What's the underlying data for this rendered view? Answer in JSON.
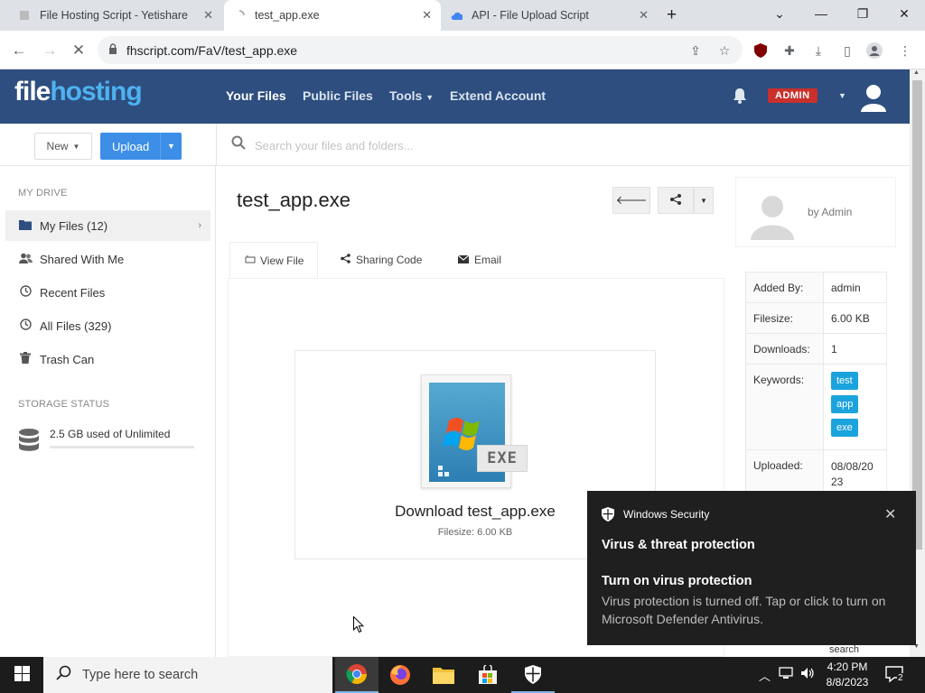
{
  "browser": {
    "tabs": [
      {
        "label": "File Hosting Script - Yetishare"
      },
      {
        "label": "test_app.exe"
      },
      {
        "label": "API - File Upload Script"
      }
    ],
    "url": "fhscript.com/FaV/test_app.exe"
  },
  "site": {
    "logo_a": "file",
    "logo_b": "hosting",
    "nav": [
      "Your Files",
      "Public Files",
      "Tools",
      "Extend Account"
    ],
    "admin_badge": "ADMIN"
  },
  "toolbar": {
    "new_label": "New",
    "upload_label": "Upload",
    "search_placeholder": "Search your files and folders..."
  },
  "sidebar": {
    "my_drive_heading": "MY DRIVE",
    "items": [
      {
        "label": "My Files (12)"
      },
      {
        "label": "Shared With Me"
      },
      {
        "label": "Recent Files"
      },
      {
        "label": "All Files (329)"
      },
      {
        "label": "Trash Can"
      }
    ],
    "storage_heading": "STORAGE STATUS",
    "storage_text": "2.5 GB used of Unlimited",
    "storage_fraction": 0
  },
  "file": {
    "title": "test_app.exe",
    "tabs": [
      "View File",
      "Sharing Code",
      "Email"
    ],
    "thumb_label": "EXE",
    "download_title": "Download test_app.exe",
    "download_size": "Filesize: 6.00 KB"
  },
  "owner": {
    "by": "by Admin"
  },
  "info": {
    "added_by_label": "Added By:",
    "added_by": "admin",
    "filesize_label": "Filesize:",
    "filesize": "6.00 KB",
    "downloads_label": "Downloads:",
    "downloads": "1",
    "keywords_label": "Keywords:",
    "keywords": [
      "test",
      "app",
      "exe"
    ],
    "uploaded_label": "Uploaded:",
    "uploaded": "08/08/2023",
    "search_tag": "search"
  },
  "toast": {
    "app": "Windows Security",
    "title": "Virus & threat protection",
    "subtitle": "Turn on virus protection",
    "body": "Virus protection is turned off. Tap or click to turn on Microsoft Defender Antivirus."
  },
  "taskbar": {
    "search_placeholder": "Type here to search",
    "time": "4:20 PM",
    "date": "8/8/2023",
    "notification_count": "2"
  },
  "colors": {
    "header": "#2d4e7e",
    "upload": "#3d8ee6",
    "keyword": "#1ba3de",
    "admin_badge": "#c9302c"
  }
}
